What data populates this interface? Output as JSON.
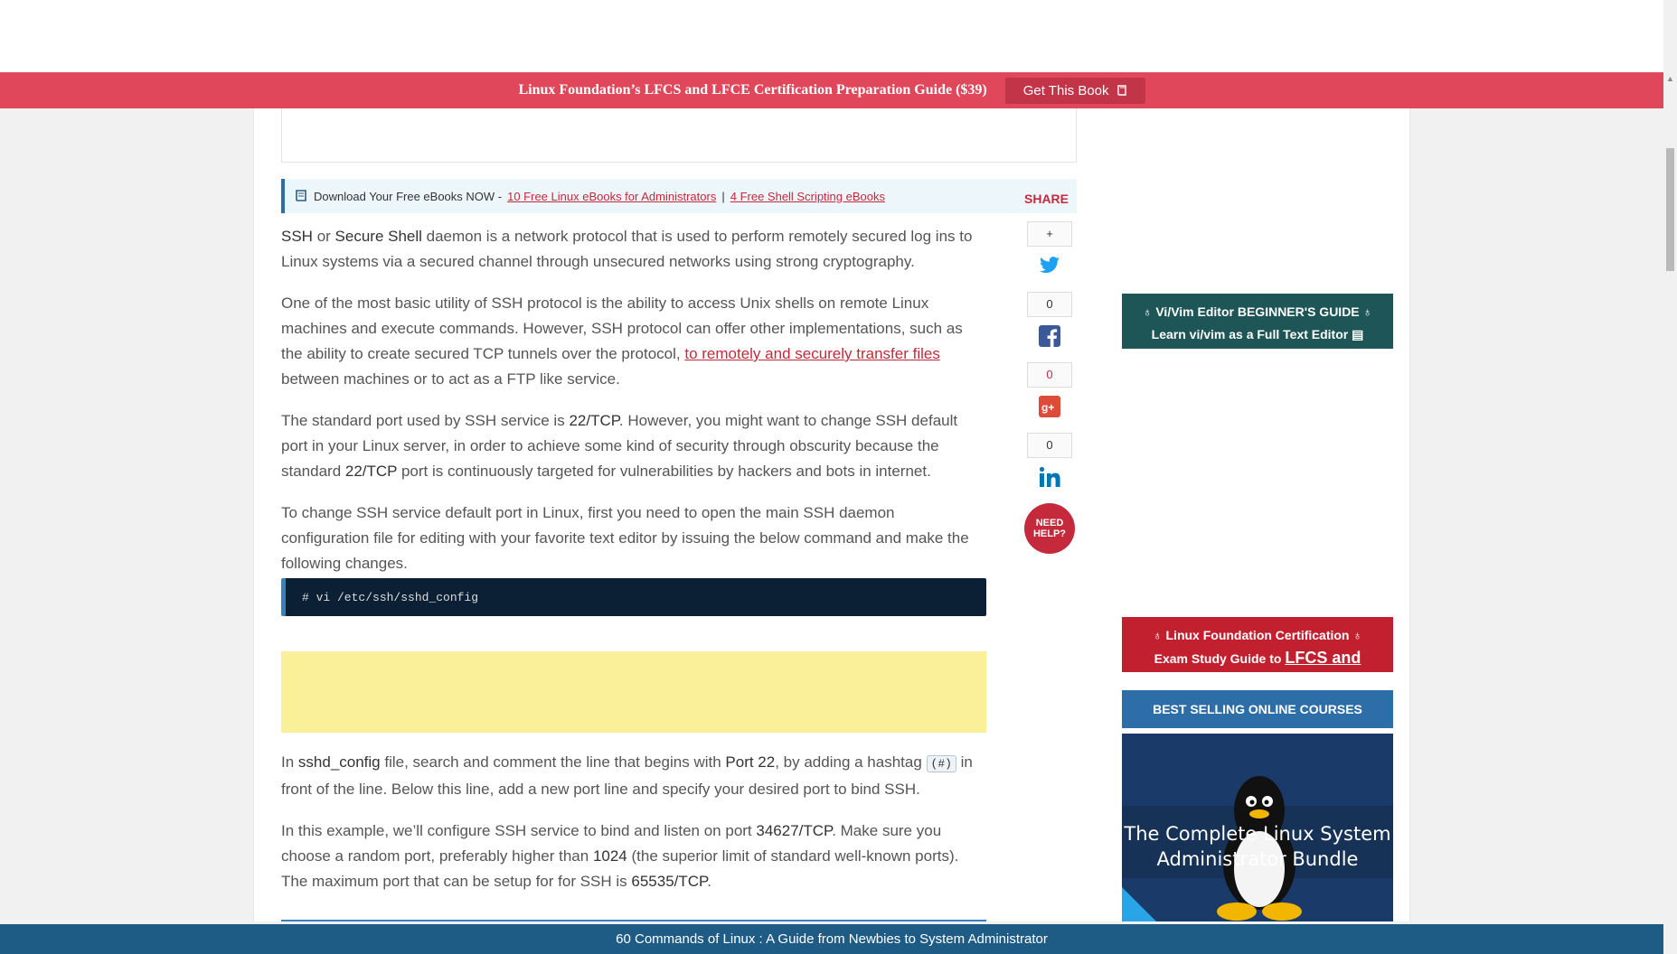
{
  "promo": {
    "text": "Linux Foundation’s LFCS and LFCE Certification Preparation Guide ($39)",
    "button_label": "Get This Book"
  },
  "ebooks": {
    "lead": "Download Your Free eBooks NOW -",
    "link1": "10 Free Linux eBooks for Administrators",
    "separator": "|",
    "link2": "4 Free Shell Scripting eBooks"
  },
  "share": {
    "label": "SHARE",
    "plus": "+",
    "twitter_count": "0",
    "facebook_count": "0",
    "googleplus_count": "0",
    "need_help": "NEED HELP?"
  },
  "article": {
    "p1_a": "SSH",
    "p1_b": " or ",
    "p1_c": "Secure Shell",
    "p1_d": " daemon is a network protocol that is used to perform remotely secured log ins to Linux systems via a secured channel through unsecured networks using strong cryptography.",
    "p2_a": "One of the most basic utility of SSH protocol is the ability to access Unix shells on remote Linux machines and execute commands. However, SSH protocol can offer other implementations, such as the ability to create secured TCP tunnels over the protocol, ",
    "p2_link": "to remotely and securely transfer files",
    "p2_b": " between machines or to act as a FTP like service.",
    "p3_a": "The standard port used by SSH service is ",
    "p3_b": "22/TCP",
    "p3_c": ". However, you might want to change SSH default port in your Linux server, in order to achieve some kind of security through obscurity because the standard ",
    "p3_d": "22/TCP",
    "p3_e": " port is continuously targeted for vulnerabilities by hackers and bots in internet.",
    "p4": "To change SSH service default port in Linux, first you need to open the main SSH daemon configuration file for editing with your favorite text editor by issuing the below command and make the following changes.",
    "code1": "# vi /etc/ssh/sshd_config",
    "p5_a": "In ",
    "p5_b": "sshd_config",
    "p5_c": " file, search and comment the line that begins with ",
    "p5_d": "Port 22",
    "p5_e": ", by adding a hashtag ",
    "p5_code": "(#)",
    "p5_f": " in front of the line. Below this line, add a new port line and specify your desired port to bind SSH.",
    "p6_a": "In this example, we’ll configure SSH service to bind and listen on port ",
    "p6_b": "34627/TCP",
    "p6_c": ". Make sure you choose a random port, preferably higher than ",
    "p6_d": "1024",
    "p6_e": " (the superior limit of standard well-known ports). The maximum port that can be setup for for SSH is ",
    "p6_f": "65535/TCP",
    "p6_g": "."
  },
  "sidebar": {
    "vim_line1": "Vi/Vim Editor BEGINNER'S GUIDE",
    "vim_line2": "Learn vi/vim as a Full Text Editor",
    "lf_line1": "Linux Foundation Certification",
    "lf_line2": "Exam Study Guide to",
    "lf_big": "LFCS and LFCE",
    "bestselling": "BEST SELLING ONLINE COURSES",
    "bundle_title": "The Complete Linux System Administrator Bundle"
  },
  "bottom_bar": {
    "text": "60 Commands of Linux : A Guide from Newbies to System Administrator"
  },
  "colors": {
    "promo": "#e0475a",
    "accent_red": "#c42a3b",
    "code_bg": "#0b2035",
    "bottom_bar": "#1e5c86"
  }
}
